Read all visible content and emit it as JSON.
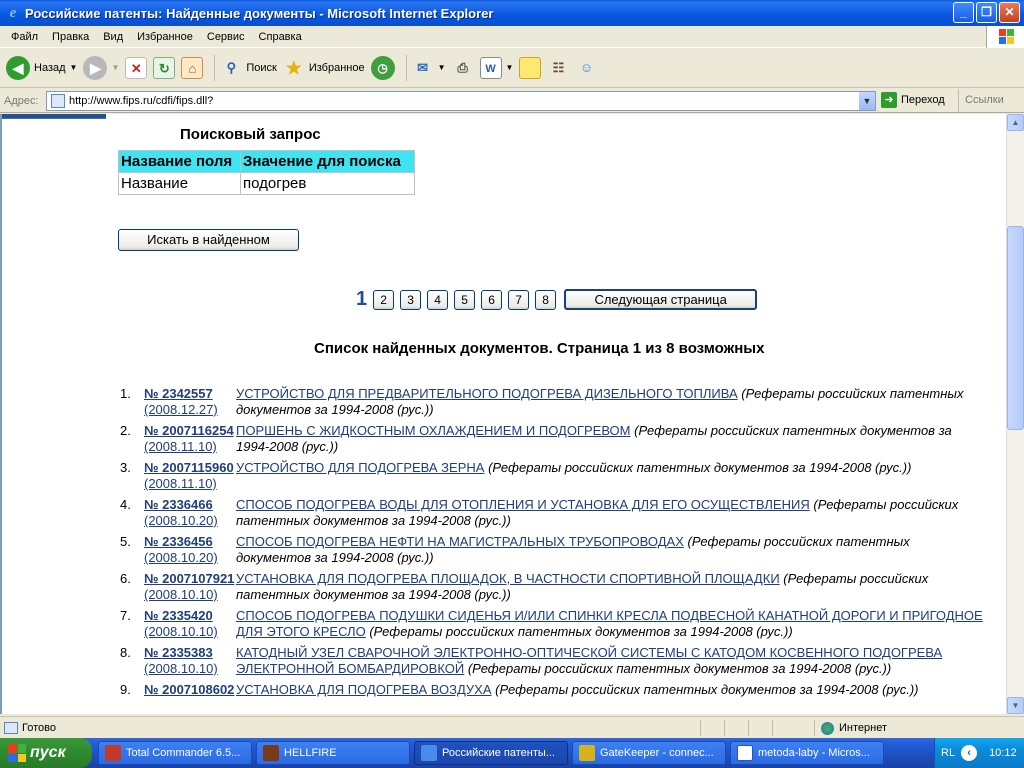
{
  "window": {
    "title": "Российские патенты: Найденные документы - Microsoft Internet Explorer",
    "icon": "ie-icon",
    "buttons": [
      "minimize",
      "maximize",
      "close"
    ]
  },
  "menu": [
    "Файл",
    "Правка",
    "Вид",
    "Избранное",
    "Сервис",
    "Справка"
  ],
  "toolbar": {
    "back": "Назад",
    "search": "Поиск",
    "favorites": "Избранное"
  },
  "address": {
    "label": "Адрес:",
    "url": "http://www.fips.ru/cdfi/fips.dll?",
    "go": "Переход",
    "links": "Ссылки"
  },
  "page": {
    "query_title": "Поисковый запрос",
    "query_table": {
      "headers": [
        "Название поля",
        "Значение для поиска"
      ],
      "rows": [
        [
          "Название",
          "подогрев"
        ]
      ]
    },
    "search_in_found": "Искать в найденном",
    "pager": {
      "current": "1",
      "pages": [
        "2",
        "3",
        "4",
        "5",
        "6",
        "7",
        "8"
      ],
      "next": "Следующая страница"
    },
    "list_title": "Список найденных документов. Страница 1 из 8 возможных",
    "results": [
      {
        "n": "1.",
        "num": "№ 2342557",
        "date": "(2008.12.27)",
        "title": "УСТРОЙСТВО ДЛЯ ПРЕДВАРИТЕЛЬНОГО ПОДОГРЕВА ДИЗЕЛЬНОГО ТОПЛИВА",
        "source": "(Рефераты российских патентных документов за 1994-2008 (рус.))"
      },
      {
        "n": "2.",
        "num": "№ 2007116254",
        "date": "(2008.11.10)",
        "title": "ПОРШЕНЬ С ЖИДКОСТНЫМ ОХЛАЖДЕНИЕМ И ПОДОГРЕВОМ",
        "source": "(Рефераты российских патентных документов за 1994-2008 (рус.))"
      },
      {
        "n": "3.",
        "num": "№ 2007115960",
        "date": "(2008.11.10)",
        "title": "УСТРОЙСТВО ДЛЯ ПОДОГРЕВА ЗЕРНА",
        "source": "(Рефераты российских патентных документов за 1994-2008 (рус.))"
      },
      {
        "n": "4.",
        "num": "№ 2336466",
        "date": "(2008.10.20)",
        "title": "СПОСОБ ПОДОГРЕВА ВОДЫ ДЛЯ ОТОПЛЕНИЯ И УСТАНОВКА ДЛЯ ЕГО ОСУЩЕСТВЛЕНИЯ",
        "source": "(Рефераты российских патентных документов за 1994-2008 (рус.))"
      },
      {
        "n": "5.",
        "num": "№ 2336456",
        "date": "(2008.10.20)",
        "title": "СПОСОБ ПОДОГРЕВА НЕФТИ НА МАГИСТРАЛЬНЫХ ТРУБОПРОВОДАХ",
        "source": "(Рефераты российских патентных документов за 1994-2008 (рус.))"
      },
      {
        "n": "6.",
        "num": "№ 2007107921",
        "date": "(2008.10.10)",
        "title": "УСТАНОВКА ДЛЯ ПОДОГРЕВА ПЛОЩАДОК, В ЧАСТНОСТИ СПОРТИВНОЙ ПЛОЩАДКИ",
        "source": "(Рефераты российских патентных документов за 1994-2008 (рус.))"
      },
      {
        "n": "7.",
        "num": "№ 2335420",
        "date": "(2008.10.10)",
        "title": "СПОСОБ ПОДОГРЕВА ПОДУШКИ СИДЕНЬЯ И/ИЛИ СПИНКИ КРЕСЛА ПОДВЕСНОЙ КАНАТНОЙ ДОРОГИ И ПРИГОДНОЕ ДЛЯ ЭТОГО КРЕСЛО",
        "source": "(Рефераты российских патентных документов за 1994-2008 (рус.))"
      },
      {
        "n": "8.",
        "num": "№ 2335383",
        "date": "(2008.10.10)",
        "title": "КАТОДНЫЙ УЗЕЛ СВАРОЧНОЙ ЭЛЕКТРОННО-ОПТИЧЕСКОЙ СИСТЕМЫ С КАТОДОМ КОСВЕННОГО ПОДОГРЕВА ЭЛЕКТРОННОЙ БОМБАРДИРОВКОЙ",
        "source": "(Рефераты российских патентных документов за 1994-2008 (рус.))"
      },
      {
        "n": "9.",
        "num": "№ 2007108602",
        "date": "",
        "title": "УСТАНОВКА ДЛЯ ПОДОГРЕВА ВОЗДУХА",
        "source": "(Рефераты российских патентных документов за 1994-2008 (рус.))"
      }
    ]
  },
  "status": {
    "text": "Готово",
    "zone": "Интернет"
  },
  "taskbar": {
    "start": "пуск",
    "tasks": [
      {
        "label": "Total Commander 6.5...",
        "color": "#C43A2A"
      },
      {
        "label": "HELLFIRE",
        "color": "#7a3a1a"
      },
      {
        "label": "Российские патенты...",
        "color": "#1a5cc8"
      },
      {
        "label": "GateKeeper - connec...",
        "color": "#d8b21c"
      },
      {
        "label": "metoda-laby - Micros...",
        "color": "#2a56b8"
      }
    ],
    "lang": "RL",
    "clock": "10:12"
  }
}
